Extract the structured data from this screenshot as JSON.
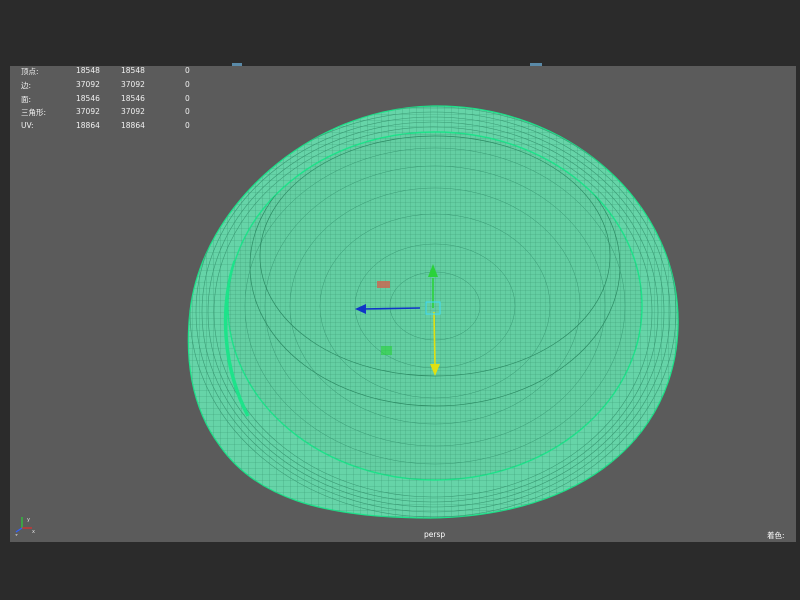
{
  "hud": {
    "rows": [
      {
        "label": "顶点:",
        "v1": "18548",
        "v2": "18548",
        "v3": "0"
      },
      {
        "label": "边:",
        "v1": "37092",
        "v2": "37092",
        "v3": "0"
      },
      {
        "label": "面:",
        "v1": "18546",
        "v2": "18546",
        "v3": "0"
      },
      {
        "label": "三角形:",
        "v1": "37092",
        "v2": "37092",
        "v3": "0"
      },
      {
        "label": "UV:",
        "v1": "18864",
        "v2": "18864",
        "v3": "0"
      }
    ]
  },
  "viewport": {
    "camera_label": "persp",
    "right_label": "着色:"
  },
  "colors": {
    "background": "#2b2b2b",
    "viewport": "#5b5b5b",
    "mesh_fill": "#66d4a8",
    "wireframe": "#3a9a74",
    "wire_highlight": "#1de38a",
    "axis_x": "#1034c8",
    "axis_y": "#2ad23a",
    "axis_z": "#e0e010"
  },
  "icons": {
    "move_manipulator": "move-manipulator-icon",
    "axis_gizmo": "axis-gizmo-icon"
  }
}
